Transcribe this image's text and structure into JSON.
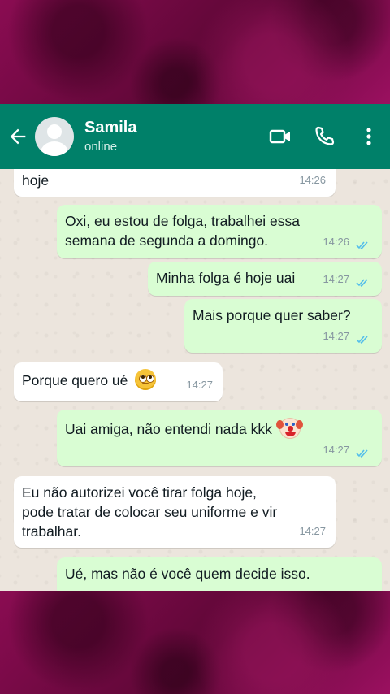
{
  "header": {
    "contact_name": "Samila",
    "status": "online",
    "colors": {
      "header_bg": "#008069",
      "chat_bg": "#ece5dd",
      "outgoing_bubble": "#d9fdd3",
      "incoming_bubble": "#ffffff",
      "read_tick": "#53bdeb"
    },
    "icons": [
      "back-arrow-icon",
      "avatar",
      "video-call-icon",
      "phone-icon",
      "more-vertical-icon"
    ]
  },
  "messages": [
    {
      "direction": "incoming",
      "text": "hoje",
      "time": "14:26"
    },
    {
      "direction": "outgoing",
      "lines": [
        "Oxi, eu estou de folga, trabalhei essa",
        "semana de segunda a domingo."
      ],
      "time": "14:26",
      "read": true
    },
    {
      "direction": "outgoing",
      "text": "Minha folga é hoje uai",
      "time": "14:27",
      "read": true
    },
    {
      "direction": "outgoing",
      "text": "Mais porque quer saber?",
      "time": "14:27",
      "read": true
    },
    {
      "direction": "incoming",
      "text": "Porque quero ué",
      "emoji": "face-with-rolling-eyes",
      "time": "14:27"
    },
    {
      "direction": "outgoing",
      "text": "Uai amiga, não entendi nada kkk",
      "emoji": "clown-face",
      "time": "14:27",
      "read": true
    },
    {
      "direction": "incoming",
      "lines": [
        "Eu não autorizei você tirar folga hoje,",
        "pode tratar de colocar seu uniforme e vir",
        "trabalhar."
      ],
      "time": "14:27"
    },
    {
      "direction": "outgoing",
      "text": "Ué, mas não é você quem decide isso."
    }
  ]
}
